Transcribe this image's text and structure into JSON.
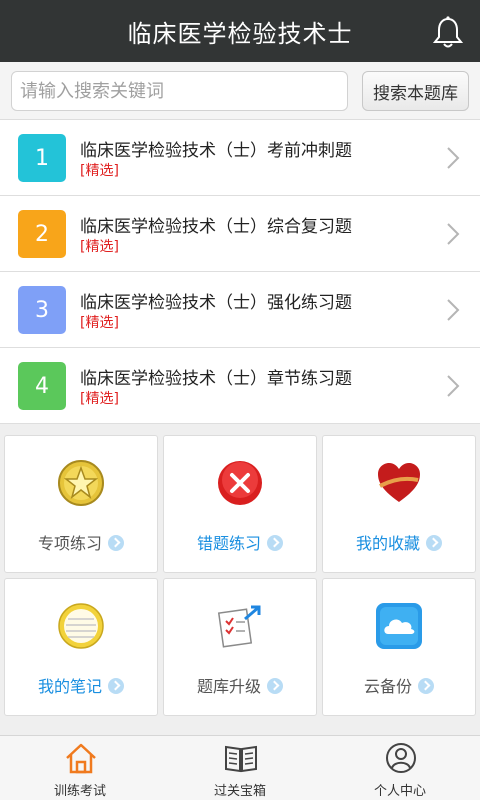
{
  "header": {
    "title": "临床医学检验技术士",
    "bell_icon": "bell-icon"
  },
  "search": {
    "placeholder": "请输入搜索关键词",
    "button_label": "搜索本题库"
  },
  "list": [
    {
      "num": "1",
      "title": "临床医学检验技术（士）考前冲刺题",
      "tag": "[精选]",
      "color": "#23c3d8"
    },
    {
      "num": "2",
      "title": "临床医学检验技术（士）综合复习题",
      "tag": "[精选]",
      "color": "#f8a51a"
    },
    {
      "num": "3",
      "title": "临床医学检验技术（士）强化练习题",
      "tag": "[精选]",
      "color": "#7fa0f7"
    },
    {
      "num": "4",
      "title": "临床医学检验技术（士）章节练习题",
      "tag": "[精选]",
      "color": "#5bc85b"
    }
  ],
  "grid": [
    {
      "label": "专项练习",
      "icon": "star-medal-icon"
    },
    {
      "label": "错题练习",
      "icon": "red-x-icon"
    },
    {
      "label": "我的收藏",
      "icon": "heart-icon"
    },
    {
      "label": "我的笔记",
      "icon": "notepad-icon"
    },
    {
      "label": "题库升级",
      "icon": "upgrade-document-icon"
    },
    {
      "label": "云备份",
      "icon": "cloud-icon"
    }
  ],
  "tabs": [
    {
      "label": "训练考试",
      "icon": "home-icon",
      "active": true
    },
    {
      "label": "过关宝箱",
      "icon": "book-icon",
      "active": false
    },
    {
      "label": "个人中心",
      "icon": "user-icon",
      "active": false
    }
  ],
  "colors": {
    "header_bg": "#323535",
    "accent_orange": "#f07a1e",
    "link_blue": "#1a8fe0",
    "tag_red": "#e02020"
  }
}
